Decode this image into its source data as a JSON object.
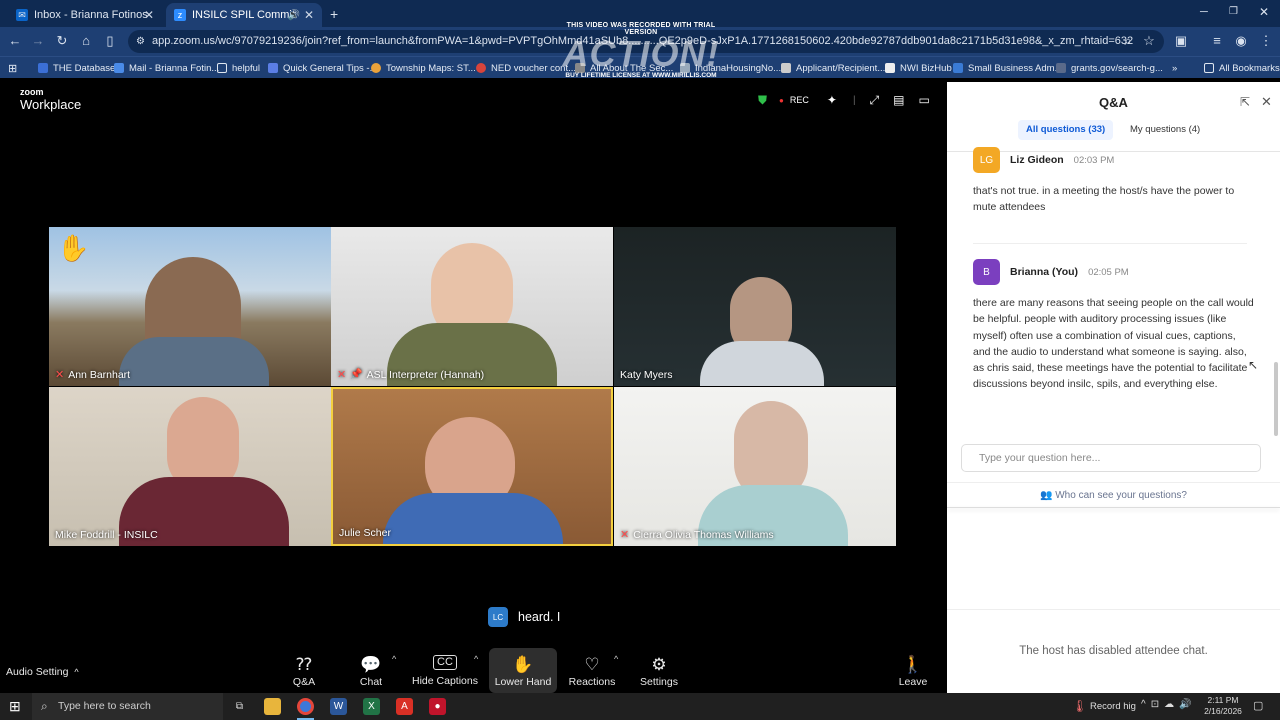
{
  "browser": {
    "tabs": [
      {
        "title": "Inbox - Brianna Fotinos - Outlo",
        "icon": "outlook-icon"
      },
      {
        "title": "INSILC SPIL Committee Me",
        "icon": "zoom-icon"
      }
    ],
    "url": "app.zoom.us/wc/97079219236/join?ref_from=launch&fromPWA=1&pwd=PVPTgOhMmd41aSUb8..........QE2p9eD-sJxP1A.1771268150602.420bde92787ddb901da8c2171b5d31e98&_x_zm_rhtaid=632",
    "bookmarks": [
      "THE Database",
      "Mail - Brianna Fotin...",
      "helpful",
      "Quick General Tips -...",
      "Township Maps: ST...",
      "NED voucher cont...",
      "All About The Sec...",
      "IndianaHousingNo...",
      "Applicant/Recipient...",
      "NWI BizHub",
      "Small Business Adm...",
      "grants.gov/search-g..."
    ],
    "all_bookmarks": "All Bookmarks"
  },
  "watermark": {
    "line1": "THIS VIDEO WAS RECORDED WITH TRIAL VERSION",
    "line2": "ACTION!",
    "line3": "BUY LIFETIME LICENSE AT WWW.MIRILLIS.COM"
  },
  "zoom": {
    "logo_top": "zoom",
    "logo_bottom": "Workplace",
    "rec_label": "REC"
  },
  "participants": [
    {
      "name": "Ann Barnhart",
      "muted": true,
      "hand_raised": true
    },
    {
      "name": "ASL Interpreter (Hannah)",
      "muted": true,
      "pinned": true
    },
    {
      "name": "Katy Myers",
      "muted": false
    },
    {
      "name": "Mike Foddrill - INSILC",
      "muted": false
    },
    {
      "name": "Julie Scher",
      "muted": false,
      "active_speaker": true
    },
    {
      "name": "Cierra Olivia Thomas Williams",
      "muted": true
    }
  ],
  "caption": {
    "avatar": "LC",
    "text": "heard. I"
  },
  "toolbar": {
    "audio_setting": "Audio Setting",
    "buttons": [
      "Q&A",
      "Chat",
      "Hide Captions",
      "Lower Hand",
      "Reactions",
      "Settings"
    ],
    "leave": "Leave"
  },
  "qa": {
    "title": "Q&A",
    "tab_all": "All questions (33)",
    "tab_mine": "My questions (4)",
    "messages": [
      {
        "initials": "LG",
        "name": "Liz Gideon",
        "time": "02:03 PM",
        "color": "#f3a825",
        "text": "that's not true. in a meeting the host/s have the power to mute attendees"
      },
      {
        "initials": "B",
        "name": "Brianna (You)",
        "time": "02:05 PM",
        "color": "#7b3fbf",
        "text": "there are many reasons that seeing people on the call would be helpful. people with auditory processing issues (like myself) often use a combination of visual cues, captions, and the audio to understand what someone is saying. also, as chris said, these meetings have the potential to facilitate discussions beyond insilc, spils, and everything else."
      }
    ],
    "input_placeholder": "Type your question here...",
    "who_can_see": "Who can see your questions?",
    "chat_disabled": "The host has disabled attendee chat."
  },
  "taskbar": {
    "search_placeholder": "Type here to search",
    "weather": "Record hig",
    "time": "2:11 PM",
    "date": "2/16/2026"
  },
  "colors": {
    "browser_dark": "#0f2a52",
    "browser_mid": "#1e3f73",
    "rec_red": "#e33",
    "qa_accent": "#0e5ad6",
    "active_speaker": "#f4d03f"
  }
}
